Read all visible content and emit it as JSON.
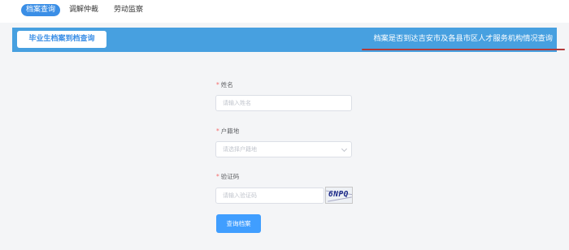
{
  "nav": {
    "tabs": [
      {
        "label": "档案查询",
        "active": true
      },
      {
        "label": "调解仲裁",
        "active": false
      },
      {
        "label": "劳动监察",
        "active": false
      }
    ]
  },
  "banner": {
    "button_label": "毕业生档案到档查询",
    "title": "档案是否到达吉安市及各县市区人才服务机构情况查询"
  },
  "form": {
    "required_mark": "*",
    "name": {
      "label": "姓名",
      "placeholder": "请输入姓名"
    },
    "household": {
      "label": "户籍地",
      "placeholder": "请选择户籍地"
    },
    "captcha": {
      "label": "验证码",
      "placeholder": "请输入验证码",
      "code": "6NPQ"
    },
    "submit_label": "查询档案"
  },
  "colors": {
    "accent": "#409eff",
    "banner": "#47a0e0",
    "underline": "#b23a3a",
    "required": "#f56c6c"
  }
}
